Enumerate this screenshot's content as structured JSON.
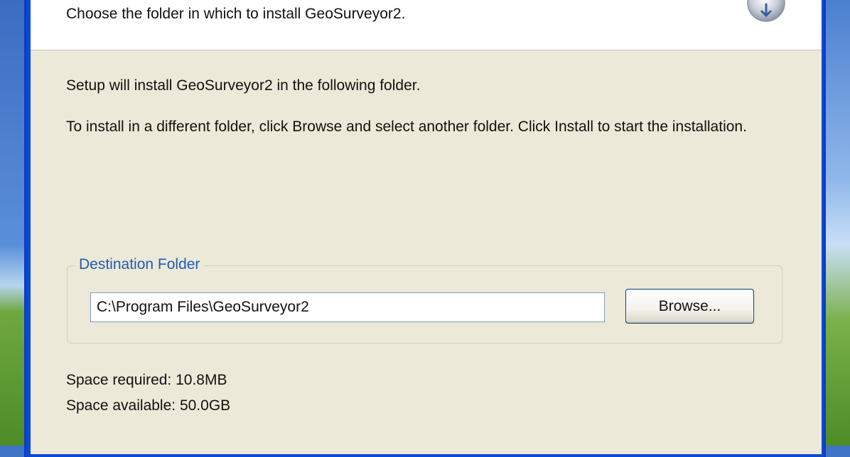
{
  "header": {
    "subtitle": "Choose the folder in which to install GeoSurveyor2.",
    "icon": "installer-disc-icon"
  },
  "body": {
    "line1": "Setup will install GeoSurveyor2 in the following folder.",
    "line2": "To install in a different folder, click Browse and select another folder. Click Install to start the installation."
  },
  "destination": {
    "legend": "Destination Folder",
    "path": "C:\\Program Files\\GeoSurveyor2",
    "browse_label": "Browse..."
  },
  "space": {
    "required": "Space required: 10.8MB",
    "available": "Space available: 50.0GB"
  },
  "colors": {
    "frame_blue": "#0a48d9",
    "dialog_bg": "#ece9d8",
    "legend_blue": "#1f5bb5"
  }
}
